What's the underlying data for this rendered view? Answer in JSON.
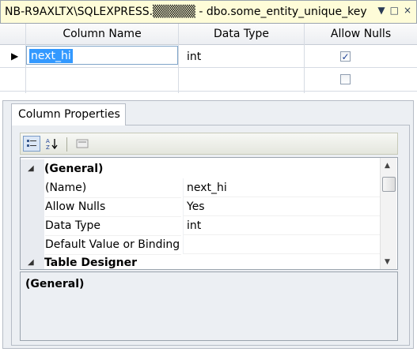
{
  "window": {
    "title": "NB-R9AXLTX\\SQLEXPRESS.▒▒▒▒▒ - dbo.some_entity_unique_key",
    "controls": [
      "▼",
      "□",
      "×"
    ]
  },
  "grid": {
    "headers": [
      "Column Name",
      "Data Type",
      "Allow Nulls"
    ],
    "rows": [
      {
        "name": "next_hi",
        "data_type": "int",
        "allow_nulls": true,
        "selected": true
      },
      {
        "name": "",
        "data_type": "",
        "allow_nulls": false,
        "selected": false
      }
    ],
    "row_marker": "▶"
  },
  "properties": {
    "tab_label": "Column Properties",
    "toolbar": [
      "categorized-icon",
      "alphabetical-icon",
      "property-pages-icon"
    ],
    "sections": [
      {
        "title": "(General)",
        "expander": "◢",
        "items": [
          {
            "name": "(Name)",
            "value": "next_hi"
          },
          {
            "name": "Allow Nulls",
            "value": "Yes"
          },
          {
            "name": "Data Type",
            "value": "int"
          },
          {
            "name": "Default Value or Binding",
            "value": ""
          }
        ]
      },
      {
        "title": "Table Designer",
        "expander": "◢",
        "items": []
      }
    ],
    "description_title": "(General)"
  },
  "colors": {
    "title_bg": "#fefcd8",
    "selection": "#3399ff",
    "pane_bg": "#eceff3"
  }
}
